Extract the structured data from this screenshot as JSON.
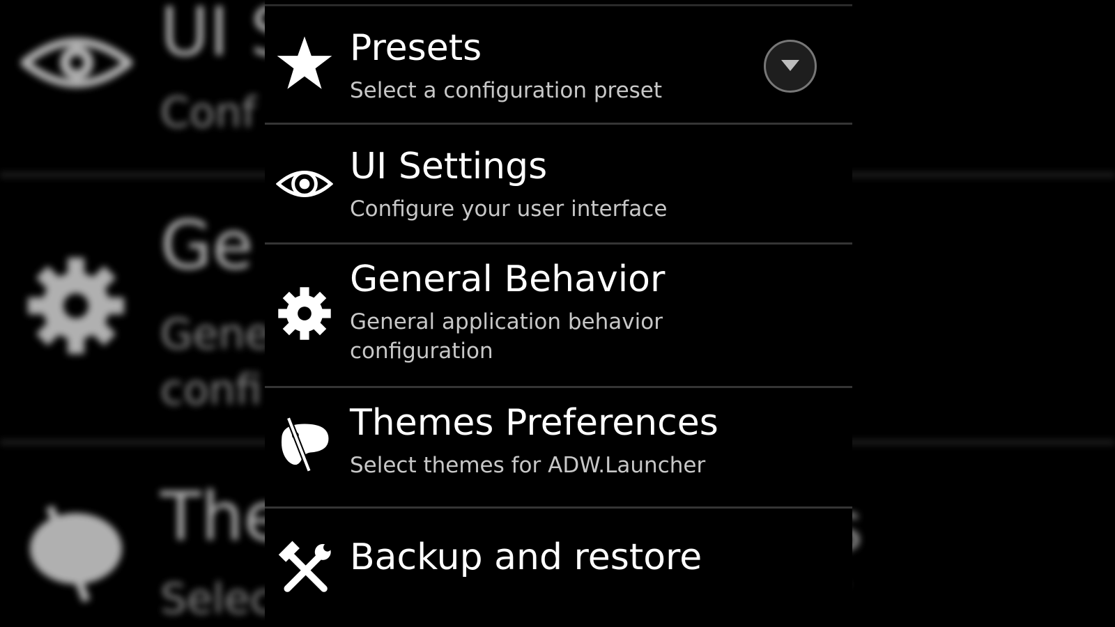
{
  "colors": {
    "background": "#000000",
    "divider": "#353535",
    "title": "#ffffff",
    "subtitle": "#c8c8c8"
  },
  "menu": {
    "items": [
      {
        "icon": "star-icon",
        "title": "Presets",
        "subtitle": "Select a configuration preset",
        "has_dropdown": true
      },
      {
        "icon": "eye-icon",
        "title": "UI Settings",
        "subtitle": "Configure your user interface"
      },
      {
        "icon": "gear-icon",
        "title": "General Behavior",
        "subtitle_line1": "General application behavior",
        "subtitle_line2": "configuration"
      },
      {
        "icon": "palette-icon",
        "title": "Themes Preferences",
        "subtitle": "Select themes for ADW.Launcher"
      },
      {
        "icon": "tools-icon",
        "title": "Backup and restore"
      }
    ],
    "dropdown_icon": "chevron-down-icon"
  },
  "background": {
    "fragments": [
      "UI S",
      "Conf",
      "Ge",
      "Gene",
      "confi",
      "The",
      "Selec",
      "s",
      "r"
    ]
  }
}
